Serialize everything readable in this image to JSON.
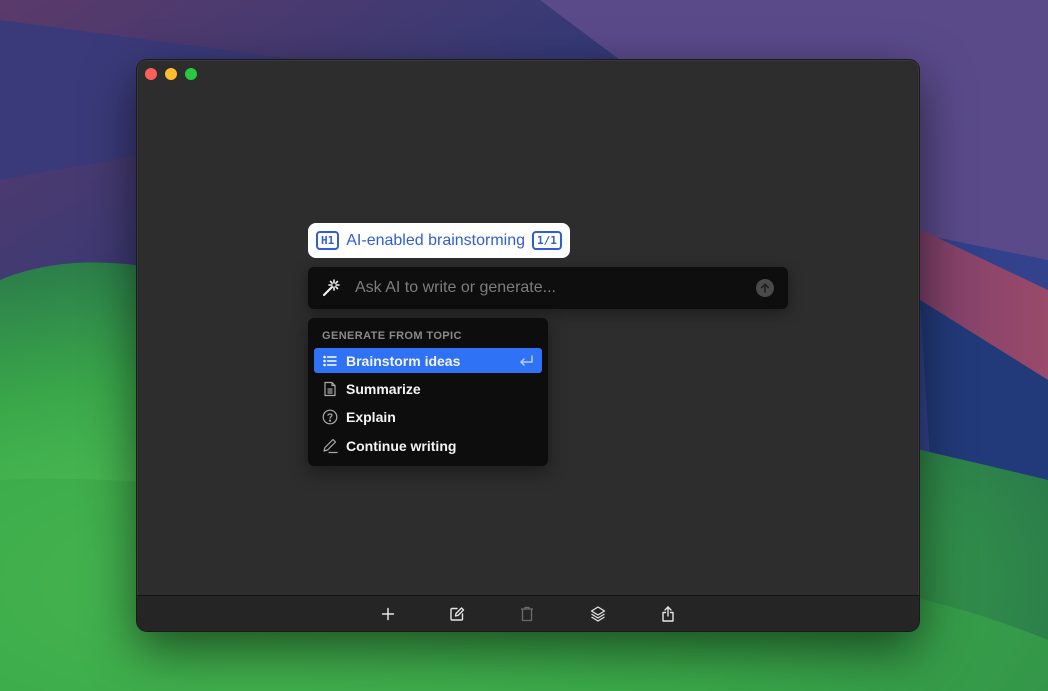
{
  "window": {
    "traffic_lights": [
      "close",
      "minimize",
      "maximize"
    ]
  },
  "heading_chip": {
    "level_badge": "H1",
    "text": "AI-enabled brainstorming",
    "count_badge": "1/1"
  },
  "ai_input": {
    "icon": "magic-wand-icon",
    "placeholder": "Ask AI to write or generate...",
    "value": "",
    "submit_icon": "arrow-up-icon"
  },
  "menu": {
    "header": "GENERATE FROM TOPIC",
    "items": [
      {
        "label": "Brainstorm ideas",
        "icon": "list-icon",
        "selected": true,
        "shortcut_icon": "enter-icon"
      },
      {
        "label": "Summarize",
        "icon": "document-icon",
        "selected": false
      },
      {
        "label": "Explain",
        "icon": "question-circle-icon",
        "selected": false
      },
      {
        "label": "Continue writing",
        "icon": "pencil-icon",
        "selected": false
      }
    ]
  },
  "toolbar": {
    "buttons": [
      {
        "name": "add",
        "icon": "plus-icon",
        "enabled": true
      },
      {
        "name": "edit",
        "icon": "edit-icon",
        "enabled": true
      },
      {
        "name": "delete",
        "icon": "trash-icon",
        "enabled": false
      },
      {
        "name": "layers",
        "icon": "layers-icon",
        "enabled": true
      },
      {
        "name": "share",
        "icon": "share-icon",
        "enabled": true
      }
    ]
  },
  "colors": {
    "accent": "#2f72f6",
    "heading_blue": "#2f5ed6",
    "window_bg": "#2d2d2d"
  }
}
